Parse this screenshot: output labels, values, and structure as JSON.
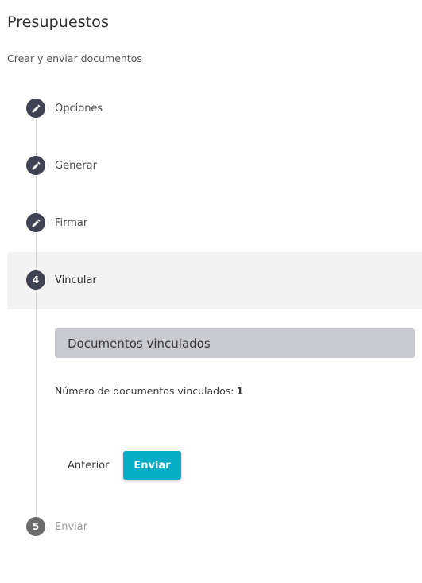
{
  "page": {
    "title": "Presupuestos",
    "subtitle": "Crear y enviar documentos"
  },
  "steps": [
    {
      "label": "Opciones",
      "state": "completed",
      "icon": "pencil-icon"
    },
    {
      "label": "Generar",
      "state": "completed",
      "icon": "pencil-icon"
    },
    {
      "label": "Firmar",
      "state": "completed",
      "icon": "pencil-icon"
    },
    {
      "label": "Vincular",
      "state": "active",
      "number": "4"
    },
    {
      "label": "Enviar",
      "state": "disabled",
      "number": "5"
    }
  ],
  "linked_section": {
    "header": "Documentos vinculados",
    "count_label": "Número de documentos vinculados:",
    "count_value": "1"
  },
  "actions": {
    "back_label": "Anterior",
    "send_label": "Enviar"
  },
  "colors": {
    "step_circle": "#3f4253",
    "step_circle_disabled": "#6c6c6c",
    "primary_button": "#06aec5",
    "section_header_bg": "#c9cacf",
    "active_step_bg": "#f3f3f3"
  }
}
